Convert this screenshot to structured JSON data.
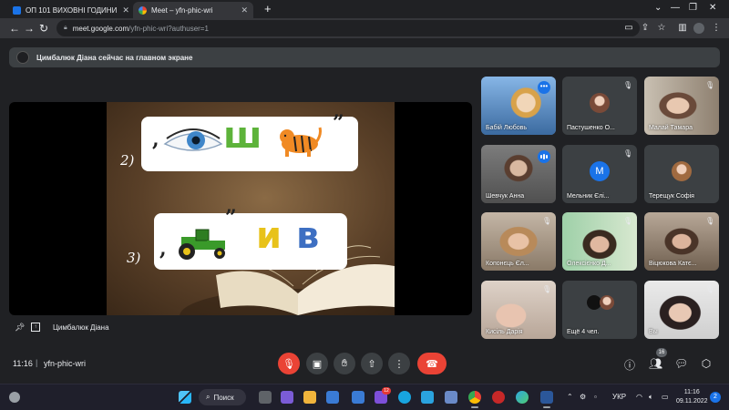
{
  "browser": {
    "tabs": [
      {
        "title": "ОП 101 ВИХОВНІ ГОДИНИ",
        "active": false,
        "close": "✕"
      },
      {
        "title": "Meet – yfn-phic-wri",
        "active": true,
        "close": "✕"
      }
    ],
    "new_tab": "+",
    "url_host": "meet.google.com",
    "url_path": "/yfn-phic-wri?authuser=1"
  },
  "banner": {
    "text": "Цимбалюк Діана сейчас на главном экране"
  },
  "slide": {
    "row1_number": "2)",
    "row1_open_quote": ",",
    "row1_letter": "ш",
    "row1_close_quote": "”",
    "row2_number": "3)",
    "row2_open_quote": ",",
    "row2_close_quote": "”",
    "row2_letters": [
      "и",
      "в"
    ],
    "colors": {
      "letter_green": "#5db33a",
      "letter_yellow": "#e8c21a",
      "letter_blue": "#3d6fc2"
    }
  },
  "presenter": {
    "name": "Цимбалюк Діана"
  },
  "participants": [
    {
      "name": "Бабій Любовь",
      "state": "more"
    },
    {
      "name": "Пастушенко О...",
      "state": "muted"
    },
    {
      "name": "Малай Тамара",
      "state": "muted"
    },
    {
      "name": "Шевчук Анна",
      "state": "speaking"
    },
    {
      "name": "Мельник Єлі...",
      "state": "muted",
      "initial": "M"
    },
    {
      "name": "Терещук Софія",
      "state": "none"
    },
    {
      "name": "Копонєць Єл...",
      "state": "muted"
    },
    {
      "name": "Олексієнко Д...",
      "state": "muted"
    },
    {
      "name": "Віцюкова Катє...",
      "state": "muted"
    },
    {
      "name": "Кисіль Дарія",
      "state": "muted"
    },
    {
      "name": "Ещё 4 чел.",
      "state": "none"
    },
    {
      "name": "Вы",
      "state": "muted"
    }
  ],
  "bottom": {
    "time": "11:16",
    "separator": "|",
    "meeting_code": "yfn-phic-wri",
    "people_count": "16"
  },
  "taskbar": {
    "search_label": "Поиск",
    "language": "УКР",
    "clock_time": "11:16",
    "clock_date": "09.11.2022",
    "notif_count": "2",
    "viber_badge": "12"
  },
  "colors": {
    "accent": "#1a73e8",
    "end_call": "#ea4335",
    "bg": "#202124",
    "tile": "#3c4043"
  }
}
